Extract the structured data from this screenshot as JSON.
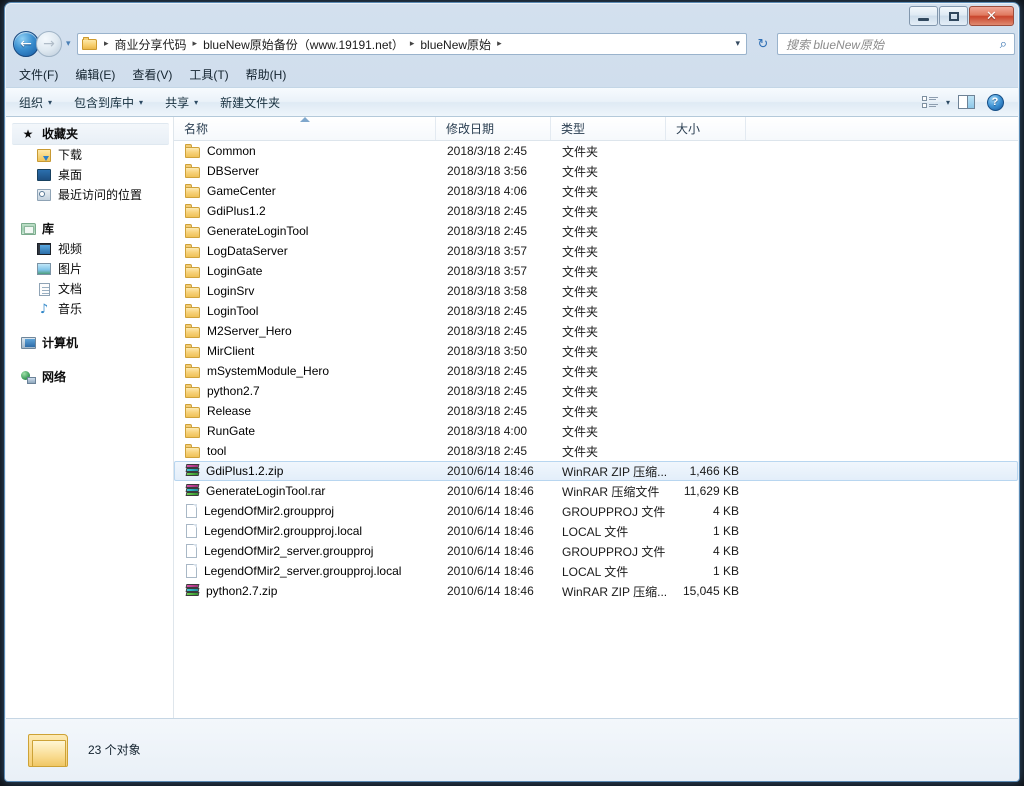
{
  "window": {
    "controls": {
      "minimize_label": "最小化",
      "maximize_label": "最大化",
      "close_label": "✕"
    }
  },
  "navigation": {
    "back_arrow": "←",
    "forward_arrow": "→",
    "history_chevron": "▾",
    "refresh_glyph": "↻"
  },
  "address": {
    "crumbs": [
      {
        "label": "商业分享代码"
      },
      {
        "label": "blueNew原始备份（www.19191.net）"
      },
      {
        "label": "blueNew原始"
      }
    ],
    "separator": "▸",
    "dropdown_glyph": "▾"
  },
  "search": {
    "placeholder": "搜索 blueNew原始",
    "icon": "search-icon",
    "icon_glyph": "⌕"
  },
  "menu": {
    "items": [
      {
        "text": "文件(F)",
        "label": "文件",
        "accel": "F"
      },
      {
        "text": "编辑(E)",
        "label": "编辑",
        "accel": "E"
      },
      {
        "text": "查看(V)",
        "label": "查看",
        "accel": "V"
      },
      {
        "text": "工具(T)",
        "label": "工具",
        "accel": "T"
      },
      {
        "text": "帮助(H)",
        "label": "帮助",
        "accel": "H"
      }
    ]
  },
  "toolbar": {
    "organize_label": "组织",
    "include_library_label": "包含到库中",
    "share_label": "共享",
    "new_folder_label": "新建文件夹",
    "caret_glyph": "▾",
    "help_glyph": "?"
  },
  "sidebar": {
    "groups": [
      {
        "header": {
          "label": "收藏夹",
          "icon": "star-icon",
          "selected": true
        },
        "items": [
          {
            "label": "下载",
            "icon": "download-icon"
          },
          {
            "label": "桌面",
            "icon": "desktop-icon"
          },
          {
            "label": "最近访问的位置",
            "icon": "recent-places-icon"
          }
        ]
      },
      {
        "header": {
          "label": "库",
          "icon": "library-icon",
          "selected": false
        },
        "items": [
          {
            "label": "视频",
            "icon": "video-icon"
          },
          {
            "label": "图片",
            "icon": "picture-icon"
          },
          {
            "label": "文档",
            "icon": "document-icon"
          },
          {
            "label": "音乐",
            "icon": "music-icon"
          }
        ]
      },
      {
        "header": {
          "label": "计算机",
          "icon": "computer-icon",
          "selected": false
        },
        "items": []
      },
      {
        "header": {
          "label": "网络",
          "icon": "network-icon",
          "selected": false
        },
        "items": []
      }
    ]
  },
  "file_list": {
    "columns": [
      {
        "key": "name",
        "label": "名称",
        "sorted": "asc"
      },
      {
        "key": "date",
        "label": "修改日期",
        "sorted": ""
      },
      {
        "key": "type",
        "label": "类型",
        "sorted": ""
      },
      {
        "key": "size",
        "label": "大小",
        "sorted": ""
      }
    ],
    "rows": [
      {
        "name": "Common",
        "date": "2018/3/18 2:45",
        "type": "文件夹",
        "size": "",
        "icon": "folder-icon",
        "selected": false
      },
      {
        "name": "DBServer",
        "date": "2018/3/18 3:56",
        "type": "文件夹",
        "size": "",
        "icon": "folder-icon",
        "selected": false
      },
      {
        "name": "GameCenter",
        "date": "2018/3/18 4:06",
        "type": "文件夹",
        "size": "",
        "icon": "folder-icon",
        "selected": false
      },
      {
        "name": "GdiPlus1.2",
        "date": "2018/3/18 2:45",
        "type": "文件夹",
        "size": "",
        "icon": "folder-icon",
        "selected": false
      },
      {
        "name": "GenerateLoginTool",
        "date": "2018/3/18 2:45",
        "type": "文件夹",
        "size": "",
        "icon": "folder-icon",
        "selected": false
      },
      {
        "name": "LogDataServer",
        "date": "2018/3/18 3:57",
        "type": "文件夹",
        "size": "",
        "icon": "folder-icon",
        "selected": false
      },
      {
        "name": "LoginGate",
        "date": "2018/3/18 3:57",
        "type": "文件夹",
        "size": "",
        "icon": "folder-icon",
        "selected": false
      },
      {
        "name": "LoginSrv",
        "date": "2018/3/18 3:58",
        "type": "文件夹",
        "size": "",
        "icon": "folder-icon",
        "selected": false
      },
      {
        "name": "LoginTool",
        "date": "2018/3/18 2:45",
        "type": "文件夹",
        "size": "",
        "icon": "folder-icon",
        "selected": false
      },
      {
        "name": "M2Server_Hero",
        "date": "2018/3/18 2:45",
        "type": "文件夹",
        "size": "",
        "icon": "folder-icon",
        "selected": false
      },
      {
        "name": "MirClient",
        "date": "2018/3/18 3:50",
        "type": "文件夹",
        "size": "",
        "icon": "folder-icon",
        "selected": false
      },
      {
        "name": "mSystemModule_Hero",
        "date": "2018/3/18 2:45",
        "type": "文件夹",
        "size": "",
        "icon": "folder-icon",
        "selected": false
      },
      {
        "name": "python2.7",
        "date": "2018/3/18 2:45",
        "type": "文件夹",
        "size": "",
        "icon": "folder-icon",
        "selected": false
      },
      {
        "name": "Release",
        "date": "2018/3/18 2:45",
        "type": "文件夹",
        "size": "",
        "icon": "folder-icon",
        "selected": false
      },
      {
        "name": "RunGate",
        "date": "2018/3/18 4:00",
        "type": "文件夹",
        "size": "",
        "icon": "folder-icon",
        "selected": false
      },
      {
        "name": "tool",
        "date": "2018/3/18 2:45",
        "type": "文件夹",
        "size": "",
        "icon": "folder-icon",
        "selected": false
      },
      {
        "name": "GdiPlus1.2.zip",
        "date": "2010/6/14 18:46",
        "type": "WinRAR ZIP 压缩...",
        "size": "1,466 KB",
        "icon": "archive-icon",
        "selected": true
      },
      {
        "name": "GenerateLoginTool.rar",
        "date": "2010/6/14 18:46",
        "type": "WinRAR 压缩文件",
        "size": "11,629 KB",
        "icon": "archive-icon",
        "selected": false
      },
      {
        "name": "LegendOfMir2.groupproj",
        "date": "2010/6/14 18:46",
        "type": "GROUPPROJ 文件",
        "size": "4 KB",
        "icon": "document-icon",
        "selected": false
      },
      {
        "name": "LegendOfMir2.groupproj.local",
        "date": "2010/6/14 18:46",
        "type": "LOCAL 文件",
        "size": "1 KB",
        "icon": "document-icon",
        "selected": false
      },
      {
        "name": "LegendOfMir2_server.groupproj",
        "date": "2010/6/14 18:46",
        "type": "GROUPPROJ 文件",
        "size": "4 KB",
        "icon": "document-icon",
        "selected": false
      },
      {
        "name": "LegendOfMir2_server.groupproj.local",
        "date": "2010/6/14 18:46",
        "type": "LOCAL 文件",
        "size": "1 KB",
        "icon": "document-icon",
        "selected": false
      },
      {
        "name": "python2.7.zip",
        "date": "2010/6/14 18:46",
        "type": "WinRAR ZIP 压缩...",
        "size": "15,045 KB",
        "icon": "archive-icon",
        "selected": false
      }
    ]
  },
  "status": {
    "text": "23 个对象",
    "count": 23
  },
  "colors": {
    "accent": "#2f6fb5",
    "selection_fill": "#e3eefa",
    "selection_border": "#b8d6f0",
    "folder_yellow": "#f7d279",
    "close_red": "#c9452c"
  }
}
